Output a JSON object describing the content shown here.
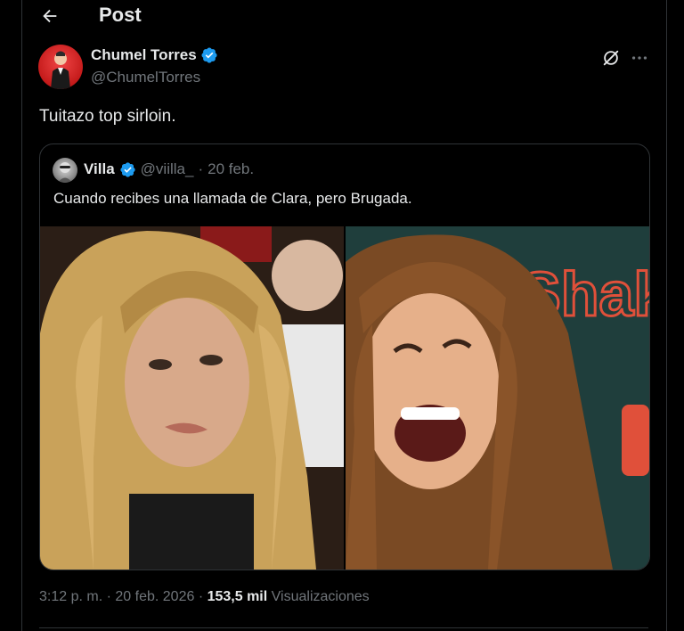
{
  "header": {
    "title": "Post"
  },
  "post": {
    "author": {
      "name": "Chumel Torres",
      "handle": "@ChumelTorres"
    },
    "text": "Tuitazo top sirloin.",
    "quote": {
      "author": {
        "name": "Villa",
        "handle": "@viilla_"
      },
      "separator": "·",
      "date": "20 feb.",
      "text": "Cuando recibes una llamada de Clara, pero Brugada.",
      "photo_right_text": "Shak"
    },
    "meta": {
      "time": "3:12 p. m.",
      "separator": "·",
      "date": "20 feb. 2026",
      "views_count": "153,5 mil",
      "views_label": "Visualizaciones"
    }
  },
  "colors": {
    "background": "#000000",
    "text_primary": "#e7e9ea",
    "text_secondary": "#71767b",
    "border": "#2f3336",
    "verified": "#1d9bf0",
    "avatar_red": "#d42b2b"
  },
  "icons": {
    "back": "arrow-left-icon",
    "verified": "verified-badge-icon",
    "grok": "grok-icon",
    "more": "more-horizontal-icon"
  }
}
